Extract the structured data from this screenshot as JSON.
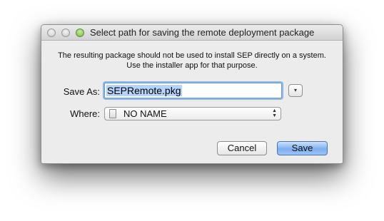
{
  "window": {
    "title": "Select path for saving the remote deployment package"
  },
  "message": {
    "line1": "The resulting package should not be used to install SEP directly on a system.",
    "line2": "Use the installer app for that purpose."
  },
  "form": {
    "save_as_label": "Save As:",
    "save_as_value": "SEPRemote.pkg",
    "expand_icon": "▾",
    "where_label": "Where:",
    "where_value": "NO NAME",
    "where_icon": "disk-icon"
  },
  "buttons": {
    "cancel_label": "Cancel",
    "save_label": "Save"
  },
  "colors": {
    "default_button": "#7eaef0",
    "focus_ring": "#8db7ea",
    "selection": "#b4d4fc"
  }
}
